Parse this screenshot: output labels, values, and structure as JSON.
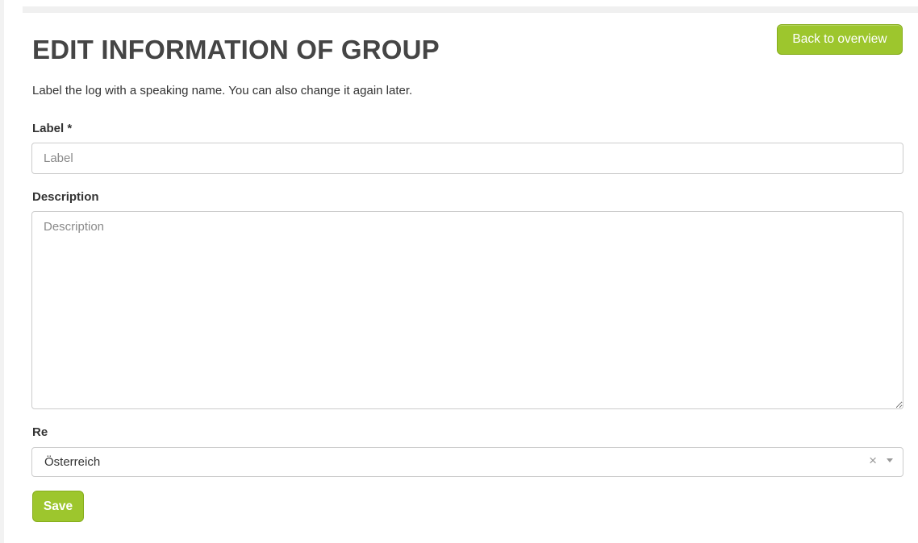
{
  "page": {
    "title": "EDIT INFORMATION OF GROUP",
    "intro": "Label the log with a speaking name. You can also change it again later."
  },
  "header": {
    "back_label": "Back to overview"
  },
  "form": {
    "label_field": {
      "label": "Label *",
      "value": "",
      "placeholder": "Label"
    },
    "description_field": {
      "label": "Description",
      "value": "",
      "placeholder": "Description"
    },
    "region_field": {
      "label": "Re",
      "selected": "Österreich",
      "clear_glyph": "×"
    },
    "save_label": "Save"
  },
  "icons": {
    "clear": "close-icon",
    "dropdown": "chevron-down-icon",
    "resize": "resize-handle-icon"
  },
  "colors": {
    "accent": "#9dc62d",
    "accent_border": "#86ad1c",
    "title": "#454545",
    "input_border": "#cccccc",
    "placeholder": "#8a8a8a"
  }
}
